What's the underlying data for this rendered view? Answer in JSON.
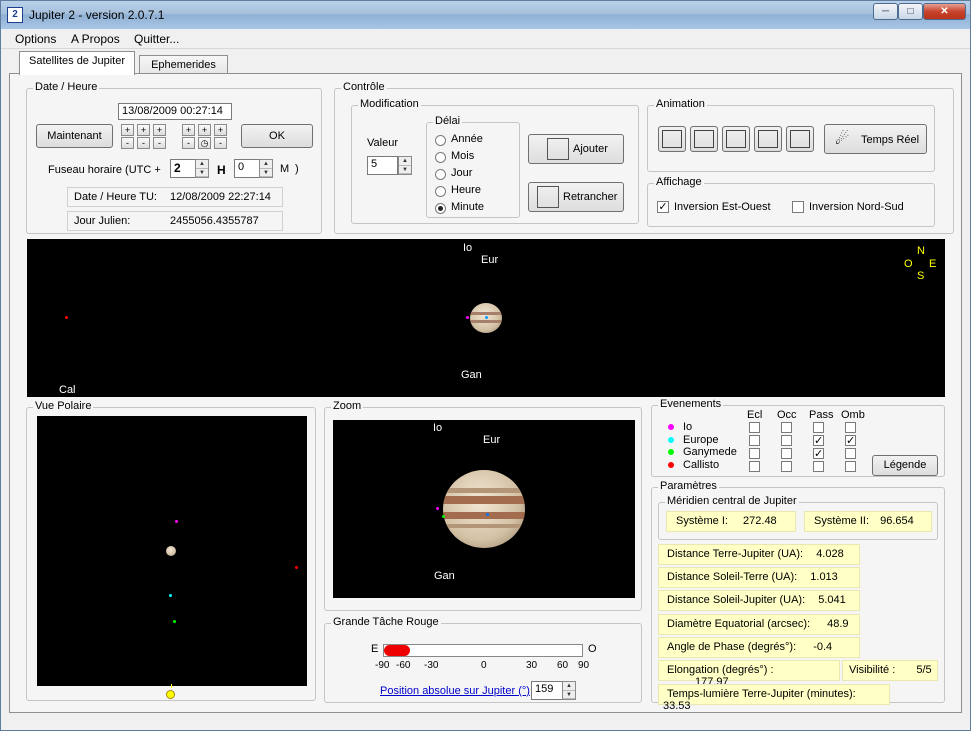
{
  "window": {
    "app_icon": "2",
    "title": "Jupiter 2 - version 2.0.7.1",
    "controls": {
      "minimize_icon": "minimize-icon",
      "maximize_icon": "maximize-icon",
      "close_icon": "close-icon"
    }
  },
  "menu": {
    "options": "Options",
    "apropos": "A Propos",
    "quitter": "Quitter..."
  },
  "tabs": {
    "satellites": "Satellites de Jupiter",
    "ephemerides": "Ephemerides"
  },
  "datetime": {
    "group_label": "Date / Heure",
    "current_value": "13/08/2009 00:27:14",
    "now_button": "Maintenant",
    "ok_button": "OK",
    "plus": "+",
    "minus": "-",
    "timezone_label": "Fuseau horaire (UTC +",
    "timezone_hours": "2",
    "hours_unit": "H",
    "timezone_minutes": "0",
    "minutes_unit": "M",
    "close_paren": ")",
    "tu_label": "Date / Heure TU:",
    "tu_value": "12/08/2009 22:27:14",
    "jd_label": "Jour Julien:",
    "jd_value": "2455056.4355787"
  },
  "controle": {
    "group_label": "Contrôle",
    "modification_label": "Modification",
    "valeur_label": "Valeur",
    "valeur": "5",
    "delai_label": "Délai",
    "delai_options": [
      "Année",
      "Mois",
      "Jour",
      "Heure",
      "Minute"
    ],
    "delai_selected": "Minute",
    "add_button": "Ajouter",
    "subtract_button": "Retrancher"
  },
  "animation": {
    "group_label": "Animation",
    "realtime_button": "Temps Réel"
  },
  "affichage": {
    "group_label": "Affichage",
    "east_west_label": "Inversion Est-Ouest",
    "east_west_checked": true,
    "north_south_label": "Inversion Nord-Sud",
    "north_south_checked": false
  },
  "main_view": {
    "labels": {
      "io": "Io",
      "eur": "Eur",
      "gan": "Gan",
      "cal": "Cal"
    },
    "compass": {
      "n": "N",
      "s": "S",
      "e": "E",
      "o": "O"
    }
  },
  "polar": {
    "group_label": "Vue Polaire"
  },
  "zoom": {
    "group_label": "Zoom",
    "labels": {
      "io": "Io",
      "eur": "Eur",
      "gan": "Gan"
    }
  },
  "grs": {
    "group_label": "Grande Tâche Rouge",
    "e_label": "E",
    "o_label": "O",
    "ticks": [
      "-90",
      "-60",
      "-30",
      "0",
      "30",
      "60",
      "90"
    ],
    "position_link": "Position absolue sur Jupiter (°)",
    "position_value": "159"
  },
  "events": {
    "group_label": "Evenements",
    "columns": [
      "Ecl",
      "Occ",
      "Pass",
      "Omb"
    ],
    "rows": [
      {
        "name": "Io",
        "color": "#ff00ff",
        "checks": [
          false,
          false,
          false,
          false
        ]
      },
      {
        "name": "Europe",
        "color": "#00ffff",
        "checks": [
          false,
          false,
          true,
          true
        ]
      },
      {
        "name": "Ganymede",
        "color": "#00ff00",
        "checks": [
          false,
          false,
          true,
          false
        ]
      },
      {
        "name": "Callisto",
        "color": "#ff0000",
        "checks": [
          false,
          false,
          false,
          false
        ]
      }
    ],
    "legend_button": "Légende"
  },
  "parametres": {
    "group_label": "Paramètres",
    "meridien_label": "Méridien central de Jupiter",
    "system1_label": "Système I:",
    "system1_value": "272.48",
    "system2_label": "Système II:",
    "system2_value": "96.654",
    "dist_tj_label": "Distance Terre-Jupiter (UA):",
    "dist_tj_value": "4.028",
    "dist_st_label": "Distance Soleil-Terre (UA):",
    "dist_st_value": "1.013",
    "dist_sj_label": "Distance Soleil-Jupiter (UA):",
    "dist_sj_value": "5.041",
    "diam_label": "Diamètre Equatorial (arcsec):",
    "diam_value": "48.9",
    "phase_label": "Angle de Phase (degrés°):",
    "phase_value": "-0.4",
    "elong_label": "Elongation (degrés°) :",
    "elong_value": "177.97",
    "visib_label": "Visibilité :",
    "visib_value": "5/5",
    "light_label": "Temps-lumière Terre-Jupiter (minutes):",
    "light_value": "33.53"
  }
}
